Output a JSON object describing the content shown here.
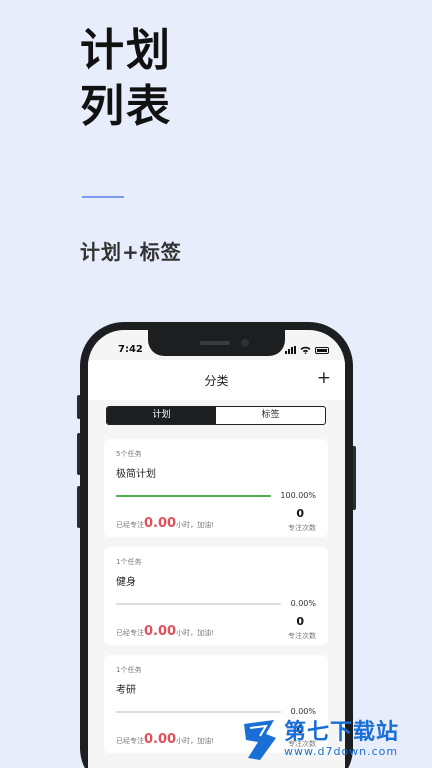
{
  "hero": {
    "title_line1": "计划",
    "title_line2": "列表",
    "subtitle": "计划+标签"
  },
  "status_bar": {
    "time": "7:42"
  },
  "nav": {
    "title": "分类",
    "add_label": "+"
  },
  "segment": {
    "tabs": [
      {
        "label": "计划",
        "selected": true
      },
      {
        "label": "标签",
        "selected": false
      }
    ]
  },
  "cards": [
    {
      "task_count": "5个任务",
      "name": "极简计划",
      "progress": 100.0,
      "progress_text": "100.00%",
      "focus_prefix": "已经专注",
      "focus_hours": "0.00",
      "focus_suffix": "小时，加油!",
      "focus_count": "0",
      "focus_count_label": "专注次数"
    },
    {
      "task_count": "1个任务",
      "name": "健身",
      "progress": 0.0,
      "progress_text": "0.00%",
      "focus_prefix": "已经专注",
      "focus_hours": "0.00",
      "focus_suffix": "小时，加油!",
      "focus_count": "0",
      "focus_count_label": "专注次数"
    },
    {
      "task_count": "1个任务",
      "name": "考研",
      "progress": 0.0,
      "progress_text": "0.00%",
      "focus_prefix": "已经专注",
      "focus_hours": "0.00",
      "focus_suffix": "小时，加油!",
      "focus_count": "0",
      "focus_count_label": "专注次数"
    }
  ],
  "colors": {
    "accent_line": "#7d9cf0",
    "progress_fill": "#4caf50",
    "focus_value": "#e0505a",
    "watermark": "#1a6fd6"
  },
  "watermark": {
    "name": "第七下载站",
    "url": "www.d7down.com"
  }
}
